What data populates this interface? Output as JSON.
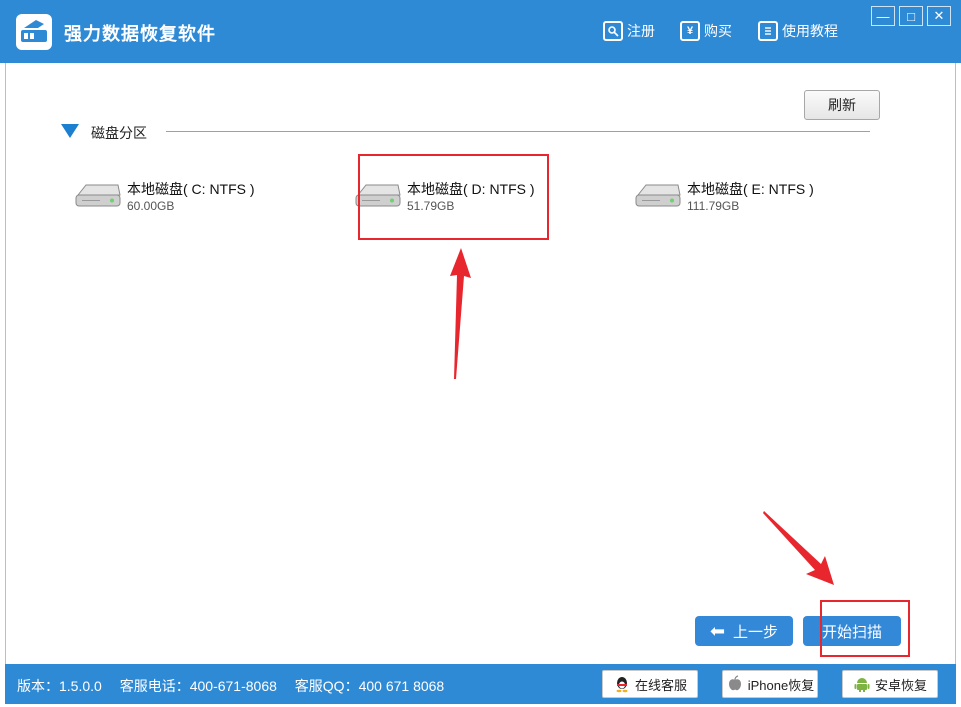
{
  "app": {
    "title": "强力数据恢复软件"
  },
  "top_links": [
    {
      "label": "注册",
      "icon": "search-key-icon"
    },
    {
      "label": "购买",
      "icon": "yen-icon"
    },
    {
      "label": "使用教程",
      "icon": "document-icon"
    }
  ],
  "window_controls": {
    "minimize": "—",
    "maximize": "□",
    "close": "✕"
  },
  "toolbar": {
    "refresh_label": "刷新"
  },
  "section": {
    "title": "磁盘分区"
  },
  "disks": [
    {
      "name": "本地磁盘( C: NTFS )",
      "size": "60.00GB"
    },
    {
      "name": "本地磁盘( D: NTFS )",
      "size": "51.79GB"
    },
    {
      "name": "本地磁盘( E: NTFS )",
      "size": "111.79GB"
    }
  ],
  "buttons": {
    "back_label": "上一步",
    "back_arrow": "⬅",
    "scan_label": "开始扫描"
  },
  "status": {
    "version": "版本：1.5.0.0",
    "phone": "客服电话：400-671-8068",
    "qq": "客服QQ：400 671 8068"
  },
  "footer_buttons": {
    "online_service": "在线客服",
    "iphone_recovery": "iPhone恢复",
    "android_recovery": "安卓恢复"
  },
  "colors": {
    "primary": "#2f8ad6",
    "button": "#3488d8",
    "highlight": "#e8262e"
  }
}
